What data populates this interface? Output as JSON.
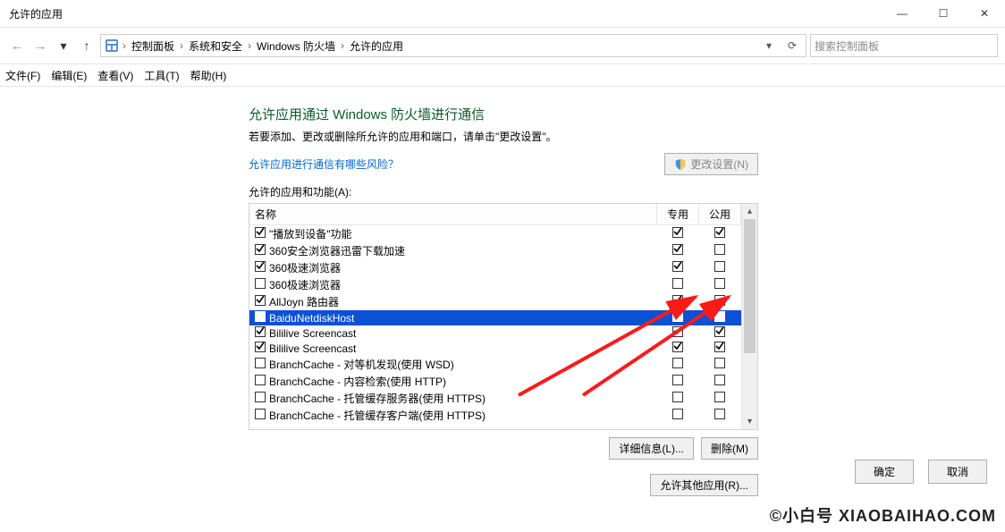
{
  "window": {
    "title": "允许的应用",
    "min": "—",
    "max": "☐",
    "close": "✕"
  },
  "nav": {
    "back": "←",
    "forward": "→",
    "up": "↑",
    "refresh": "⟳",
    "dropdown": "▾"
  },
  "breadcrumb": [
    "控制面板",
    "系统和安全",
    "Windows 防火墙",
    "允许的应用"
  ],
  "search": {
    "placeholder": "搜索控制面板"
  },
  "menubar": [
    "文件(F)",
    "编辑(E)",
    "查看(V)",
    "工具(T)",
    "帮助(H)"
  ],
  "heading": "允许应用通过 Windows 防火墙进行通信",
  "description": "若要添加、更改或删除所允许的应用和端口，请单击\"更改设置\"。",
  "risk_link": "允许应用进行通信有哪些风险？",
  "change_settings": "更改设置(N)",
  "list_label": "允许的应用和功能(A):",
  "columns": {
    "name": "名称",
    "private": "专用",
    "public": "公用"
  },
  "rows": [
    {
      "enabled": true,
      "name": "\"播放到设备\"功能",
      "private": true,
      "public": true
    },
    {
      "enabled": true,
      "name": "360安全浏览器迅雷下载加速",
      "private": true,
      "public": false
    },
    {
      "enabled": true,
      "name": "360极速浏览器",
      "private": true,
      "public": false
    },
    {
      "enabled": false,
      "name": "360极速浏览器",
      "private": false,
      "public": false
    },
    {
      "enabled": true,
      "name": "AllJoyn 路由器",
      "private": true,
      "public": false
    },
    {
      "enabled": true,
      "name": "BaiduNetdiskHost",
      "private": true,
      "public": true,
      "selected": true
    },
    {
      "enabled": true,
      "name": "Bililive Screencast",
      "private": true,
      "public": true
    },
    {
      "enabled": true,
      "name": "Bililive Screencast",
      "private": true,
      "public": true
    },
    {
      "enabled": false,
      "name": "BranchCache - 对等机发现(使用 WSD)",
      "private": false,
      "public": false
    },
    {
      "enabled": false,
      "name": "BranchCache - 内容检索(使用 HTTP)",
      "private": false,
      "public": false
    },
    {
      "enabled": false,
      "name": "BranchCache - 托管缓存服务器(使用 HTTPS)",
      "private": false,
      "public": false
    },
    {
      "enabled": false,
      "name": "BranchCache - 托管缓存客户端(使用 HTTPS)",
      "private": false,
      "public": false
    }
  ],
  "buttons": {
    "details": "详细信息(L)...",
    "remove": "删除(M)",
    "allow_other": "允许其他应用(R)...",
    "ok": "确定",
    "cancel": "取消"
  },
  "watermark": "©小白号 XIAOBAIHAO.COM"
}
